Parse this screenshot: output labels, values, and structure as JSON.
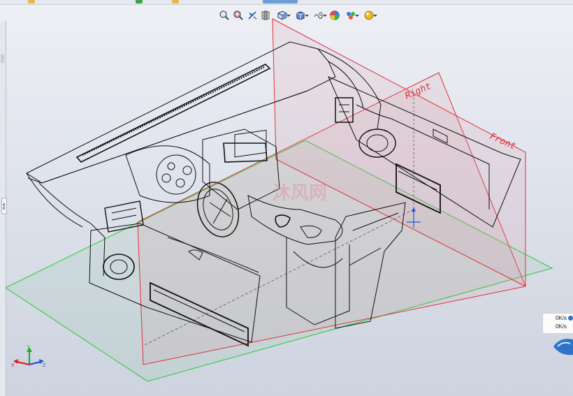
{
  "toolbar": {
    "items": [
      {
        "icon": "zoom-to-fit-icon"
      },
      {
        "icon": "zoom-to-area-icon"
      },
      {
        "icon": "previous-view-icon"
      },
      {
        "icon": "section-view-icon"
      },
      {
        "icon": "view-orientation-icon",
        "dropdown": true
      },
      {
        "icon": "display-style-icon",
        "dropdown": true
      },
      {
        "icon": "hide-show-items-icon",
        "dropdown": true
      },
      {
        "icon": "edit-appearance-icon"
      },
      {
        "icon": "apply-scene-icon",
        "dropdown": true
      },
      {
        "icon": "view-settings-icon",
        "dropdown": true
      }
    ]
  },
  "viewport": {
    "planes": {
      "right": {
        "label": "Right"
      },
      "front": {
        "label": "Front"
      }
    },
    "watermark": "沐风网"
  },
  "triad": {
    "x": "X",
    "y": "Y",
    "z": "Z"
  },
  "network_widget": {
    "upload": "0K/s",
    "download": "0K/s"
  },
  "colors": {
    "plane_front_right": "#e0303a",
    "plane_top": "#33cc44",
    "background_top": "#eef0f5",
    "background_bottom": "#cdd3df"
  }
}
